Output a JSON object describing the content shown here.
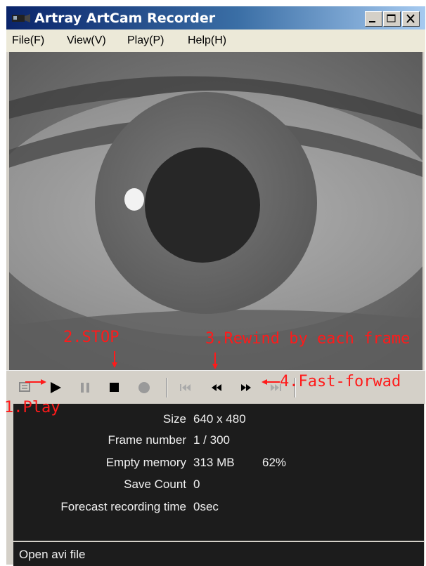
{
  "window": {
    "title": "Artray ArtCam Recorder"
  },
  "menu": [
    {
      "label": "File(F)"
    },
    {
      "label": "View(V)"
    },
    {
      "label": "Play(P)"
    },
    {
      "label": "Help(H)"
    }
  ],
  "toolbar": {
    "icons": [
      "open-icon",
      "play-icon",
      "pause-icon",
      "stop-icon",
      "record-icon",
      "go-to-start-icon",
      "rewind-frame-icon",
      "forward-frame-icon",
      "fast-forward-icon"
    ]
  },
  "info": {
    "size_label": "Size",
    "size_value": "640 x 480",
    "frame_label": "Frame number",
    "frame_value": "1 / 300",
    "memory_label": "Empty memory",
    "memory_value": "313 MB",
    "memory_percent": "62%",
    "save_label": "Save Count",
    "save_value": "0",
    "forecast_label": "Forecast recording time",
    "forecast_value": "0sec"
  },
  "status": {
    "text": "Open avi file"
  },
  "annotations": {
    "play": "1.Play",
    "stop": "2.STOP",
    "rewind": "3.Rewind by each frame",
    "fast_forward": "4.Fast-forwad"
  },
  "colors": {
    "annotation": "#ff1a1a",
    "titlebar": "#0a246a",
    "panel": "#1c1c1c"
  }
}
